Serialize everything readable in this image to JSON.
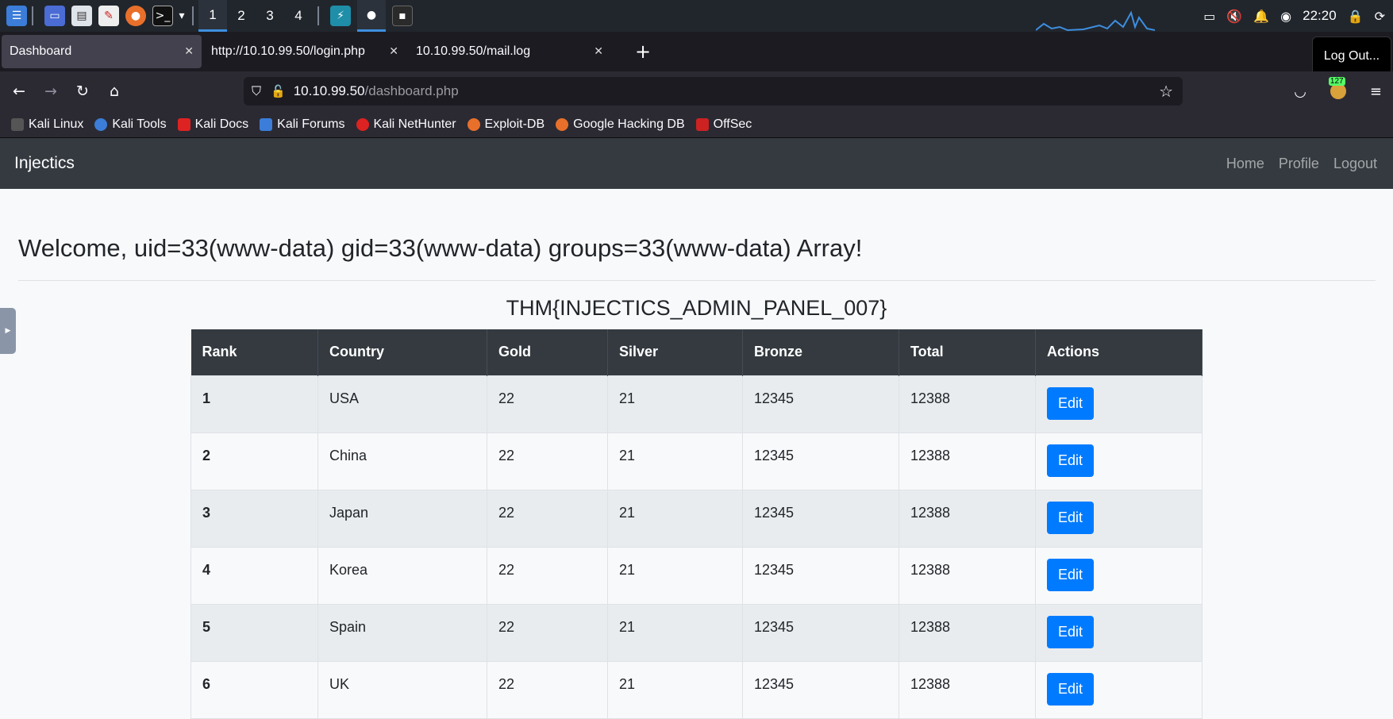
{
  "taskbar": {
    "workspaces": [
      "1",
      "2",
      "3",
      "4"
    ],
    "clock": "22:20",
    "icons": [
      "kali-menu-icon",
      "desktop-icon",
      "file-manager-icon",
      "text-editor-icon",
      "firefox-icon",
      "terminal-icon"
    ]
  },
  "browser": {
    "tabs": [
      {
        "label": "Dashboard",
        "active": true
      },
      {
        "label": "http://10.10.99.50/login.php",
        "active": false
      },
      {
        "label": "10.10.99.50/mail.log",
        "active": false
      }
    ],
    "tooltip": "Log Out...",
    "url_host": "10.10.99.50",
    "url_path": "/dashboard.php",
    "extension_badge": "127",
    "bookmarks": [
      "Kali Linux",
      "Kali Tools",
      "Kali Docs",
      "Kali Forums",
      "Kali NetHunter",
      "Exploit-DB",
      "Google Hacking DB",
      "OffSec"
    ]
  },
  "site": {
    "brand": "Injectics",
    "links": [
      "Home",
      "Profile",
      "Logout"
    ],
    "welcome": "Welcome, uid=33(www-data) gid=33(www-data) groups=33(www-data) Array!",
    "flag": "THM{INJECTICS_ADMIN_PANEL_007}"
  },
  "table": {
    "headers": [
      "Rank",
      "Country",
      "Gold",
      "Silver",
      "Bronze",
      "Total",
      "Actions"
    ],
    "rows": [
      {
        "rank": "1",
        "country": "USA",
        "gold": "22",
        "silver": "21",
        "bronze": "12345",
        "total": "12388",
        "action": "Edit"
      },
      {
        "rank": "2",
        "country": "China",
        "gold": "22",
        "silver": "21",
        "bronze": "12345",
        "total": "12388",
        "action": "Edit"
      },
      {
        "rank": "3",
        "country": "Japan",
        "gold": "22",
        "silver": "21",
        "bronze": "12345",
        "total": "12388",
        "action": "Edit"
      },
      {
        "rank": "4",
        "country": "Korea",
        "gold": "22",
        "silver": "21",
        "bronze": "12345",
        "total": "12388",
        "action": "Edit"
      },
      {
        "rank": "5",
        "country": "Spain",
        "gold": "22",
        "silver": "21",
        "bronze": "12345",
        "total": "12388",
        "action": "Edit"
      },
      {
        "rank": "6",
        "country": "UK",
        "gold": "22",
        "silver": "21",
        "bronze": "12345",
        "total": "12388",
        "action": "Edit"
      }
    ]
  }
}
